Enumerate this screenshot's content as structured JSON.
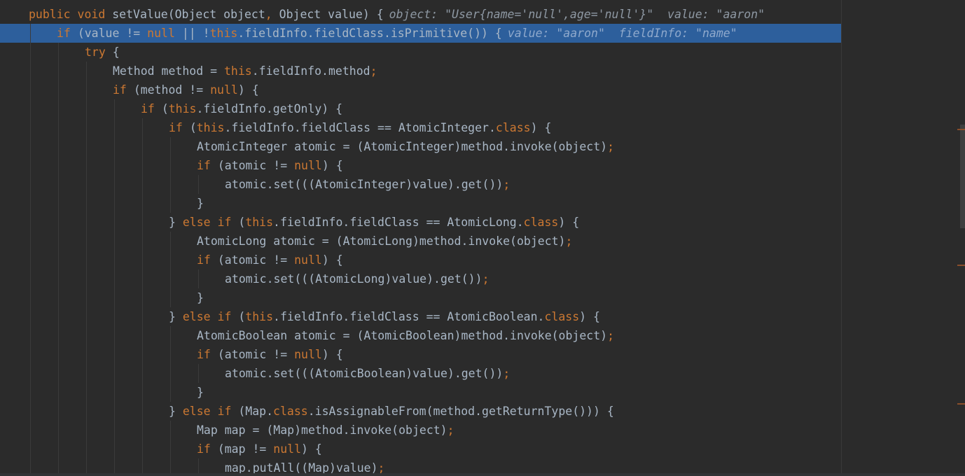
{
  "editor": {
    "lines": [
      {
        "indent": 1,
        "current": false,
        "tokens": [
          {
            "t": "public void ",
            "c": "kw"
          },
          {
            "t": "setValue(Object object"
          },
          {
            "t": ", ",
            "c": "kw"
          },
          {
            "t": "Object value) {"
          }
        ],
        "hint": "object: \"User{name='null',age='null'}\"  value: \"aaron\""
      },
      {
        "indent": 2,
        "current": true,
        "tokens": [
          {
            "t": "if ",
            "c": "kw"
          },
          {
            "t": "(value != "
          },
          {
            "t": "null",
            "c": "kw"
          },
          {
            "t": " || !"
          },
          {
            "t": "this",
            "c": "kw"
          },
          {
            "t": ".fieldInfo.fieldClass.isPrimitive()) {"
          }
        ],
        "hint": "value: \"aaron\"  fieldInfo: \"name\""
      },
      {
        "indent": 3,
        "current": false,
        "tokens": [
          {
            "t": "try ",
            "c": "kw"
          },
          {
            "t": "{"
          }
        ]
      },
      {
        "indent": 4,
        "current": false,
        "tokens": [
          {
            "t": "Method method = "
          },
          {
            "t": "this",
            "c": "kw"
          },
          {
            "t": ".fieldInfo.method"
          },
          {
            "t": ";",
            "c": "kw"
          }
        ]
      },
      {
        "indent": 4,
        "current": false,
        "tokens": [
          {
            "t": "if ",
            "c": "kw"
          },
          {
            "t": "(method != "
          },
          {
            "t": "null",
            "c": "kw"
          },
          {
            "t": ") {"
          }
        ]
      },
      {
        "indent": 5,
        "current": false,
        "tokens": [
          {
            "t": "if ",
            "c": "kw"
          },
          {
            "t": "("
          },
          {
            "t": "this",
            "c": "kw"
          },
          {
            "t": ".fieldInfo.getOnly) {"
          }
        ]
      },
      {
        "indent": 6,
        "current": false,
        "tokens": [
          {
            "t": "if ",
            "c": "kw"
          },
          {
            "t": "("
          },
          {
            "t": "this",
            "c": "kw"
          },
          {
            "t": ".fieldInfo.fieldClass == AtomicInteger."
          },
          {
            "t": "class",
            "c": "kw"
          },
          {
            "t": ") {"
          }
        ]
      },
      {
        "indent": 7,
        "current": false,
        "tokens": [
          {
            "t": "AtomicInteger atomic = (AtomicInteger)method.invoke(object)"
          },
          {
            "t": ";",
            "c": "kw"
          }
        ]
      },
      {
        "indent": 7,
        "current": false,
        "tokens": [
          {
            "t": "if ",
            "c": "kw"
          },
          {
            "t": "(atomic != "
          },
          {
            "t": "null",
            "c": "kw"
          },
          {
            "t": ") {"
          }
        ]
      },
      {
        "indent": 8,
        "current": false,
        "tokens": [
          {
            "t": "atomic.set(((AtomicInteger)value).get())"
          },
          {
            "t": ";",
            "c": "kw"
          }
        ]
      },
      {
        "indent": 7,
        "current": false,
        "tokens": [
          {
            "t": "}"
          }
        ]
      },
      {
        "indent": 6,
        "current": false,
        "tokens": [
          {
            "t": "} "
          },
          {
            "t": "else if ",
            "c": "kw"
          },
          {
            "t": "("
          },
          {
            "t": "this",
            "c": "kw"
          },
          {
            "t": ".fieldInfo.fieldClass == AtomicLong."
          },
          {
            "t": "class",
            "c": "kw"
          },
          {
            "t": ") {"
          }
        ]
      },
      {
        "indent": 7,
        "current": false,
        "tokens": [
          {
            "t": "AtomicLong atomic = (AtomicLong)method.invoke(object)"
          },
          {
            "t": ";",
            "c": "kw"
          }
        ]
      },
      {
        "indent": 7,
        "current": false,
        "tokens": [
          {
            "t": "if ",
            "c": "kw"
          },
          {
            "t": "(atomic != "
          },
          {
            "t": "null",
            "c": "kw"
          },
          {
            "t": ") {"
          }
        ]
      },
      {
        "indent": 8,
        "current": false,
        "tokens": [
          {
            "t": "atomic.set(((AtomicLong)value).get())"
          },
          {
            "t": ";",
            "c": "kw"
          }
        ]
      },
      {
        "indent": 7,
        "current": false,
        "tokens": [
          {
            "t": "}"
          }
        ]
      },
      {
        "indent": 6,
        "current": false,
        "tokens": [
          {
            "t": "} "
          },
          {
            "t": "else if ",
            "c": "kw"
          },
          {
            "t": "("
          },
          {
            "t": "this",
            "c": "kw"
          },
          {
            "t": ".fieldInfo.fieldClass == AtomicBoolean."
          },
          {
            "t": "class",
            "c": "kw"
          },
          {
            "t": ") {"
          }
        ]
      },
      {
        "indent": 7,
        "current": false,
        "tokens": [
          {
            "t": "AtomicBoolean atomic = (AtomicBoolean)method.invoke(object)"
          },
          {
            "t": ";",
            "c": "kw"
          }
        ]
      },
      {
        "indent": 7,
        "current": false,
        "tokens": [
          {
            "t": "if ",
            "c": "kw"
          },
          {
            "t": "(atomic != "
          },
          {
            "t": "null",
            "c": "kw"
          },
          {
            "t": ") {"
          }
        ]
      },
      {
        "indent": 8,
        "current": false,
        "tokens": [
          {
            "t": "atomic.set(((AtomicBoolean)value).get())"
          },
          {
            "t": ";",
            "c": "kw"
          }
        ]
      },
      {
        "indent": 7,
        "current": false,
        "tokens": [
          {
            "t": "}"
          }
        ]
      },
      {
        "indent": 6,
        "current": false,
        "tokens": [
          {
            "t": "} "
          },
          {
            "t": "else if ",
            "c": "kw"
          },
          {
            "t": "(Map."
          },
          {
            "t": "class",
            "c": "kw"
          },
          {
            "t": ".isAssignableFrom(method.getReturnType())) {"
          }
        ]
      },
      {
        "indent": 7,
        "current": false,
        "tokens": [
          {
            "t": "Map map = (Map)method.invoke(object)"
          },
          {
            "t": ";",
            "c": "kw"
          }
        ]
      },
      {
        "indent": 7,
        "current": false,
        "tokens": [
          {
            "t": "if ",
            "c": "kw"
          },
          {
            "t": "(map != "
          },
          {
            "t": "null",
            "c": "kw"
          },
          {
            "t": ") {"
          }
        ]
      },
      {
        "indent": 8,
        "current": false,
        "tokens": [
          {
            "t": "map.putAll((Map)value)"
          },
          {
            "t": ";",
            "c": "kw"
          }
        ]
      }
    ]
  },
  "colors": {
    "background": "#2b2b2b",
    "text": "#a9b7c6",
    "keyword": "#cc7832",
    "current_line": "#2d5f9c",
    "inlay_hint": "#8e98a3"
  }
}
